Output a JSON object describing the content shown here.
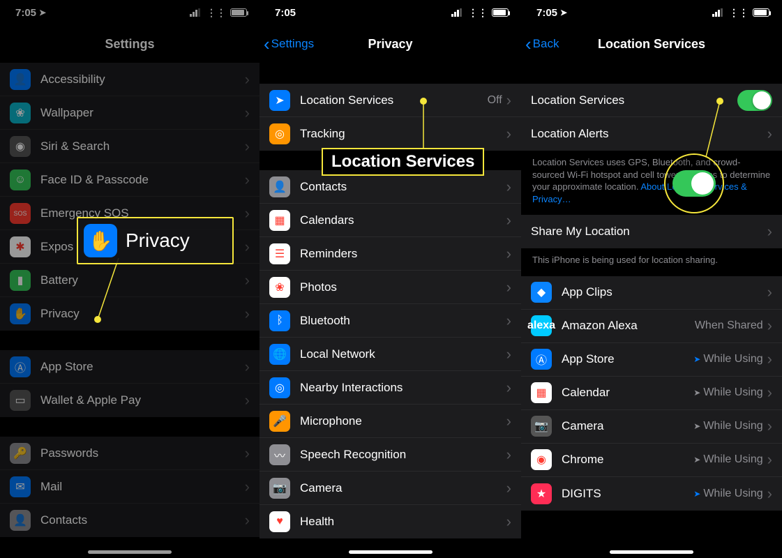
{
  "status": {
    "time": "7:05"
  },
  "screen1": {
    "title": "Settings",
    "group1": [
      {
        "label": "Accessibility",
        "icon": "👤",
        "bg": "bg-blue",
        "name": "accessibility"
      },
      {
        "label": "Wallpaper",
        "icon": "❀",
        "bg": "bg-cyan",
        "name": "wallpaper"
      },
      {
        "label": "Siri & Search",
        "icon": "◉",
        "bg": "bg-darkgray",
        "name": "siri-search"
      },
      {
        "label": "Face ID & Passcode",
        "icon": "☺",
        "bg": "bg-green",
        "name": "faceid"
      },
      {
        "label": "Emergency SOS",
        "icon": "SOS",
        "bg": "bg-red",
        "name": "emergency-sos",
        "small": true
      },
      {
        "label": "Exposure Notifications",
        "icon": "✱",
        "bg": "bg-white",
        "name": "exposure",
        "cut": "Expos"
      },
      {
        "label": "Battery",
        "icon": "▮",
        "bg": "bg-green",
        "name": "battery"
      },
      {
        "label": "Privacy",
        "icon": "✋",
        "bg": "bg-blue",
        "name": "privacy"
      }
    ],
    "group2": [
      {
        "label": "App Store",
        "icon": "Ⓐ",
        "bg": "bg-blue",
        "name": "app-store"
      },
      {
        "label": "Wallet & Apple Pay",
        "icon": "▭",
        "bg": "bg-darkgray",
        "name": "wallet"
      }
    ],
    "group3": [
      {
        "label": "Passwords",
        "icon": "🔑",
        "bg": "bg-gray",
        "name": "passwords"
      },
      {
        "label": "Mail",
        "icon": "✉",
        "bg": "bg-blue",
        "name": "mail"
      },
      {
        "label": "Contacts",
        "icon": "👤",
        "bg": "bg-gray",
        "name": "contacts"
      }
    ],
    "callout_label": "Privacy"
  },
  "screen2": {
    "back": "Settings",
    "title": "Privacy",
    "group1": [
      {
        "label": "Location Services",
        "icon": "➤",
        "bg": "bg-blue",
        "value": "Off",
        "name": "location-services"
      },
      {
        "label": "Tracking",
        "icon": "◎",
        "bg": "bg-orange",
        "name": "tracking"
      }
    ],
    "group2": [
      {
        "label": "Contacts",
        "icon": "👤",
        "bg": "bg-gray",
        "name": "contacts"
      },
      {
        "label": "Calendars",
        "icon": "▦",
        "bg": "bg-white",
        "name": "calendars"
      },
      {
        "label": "Reminders",
        "icon": "☰",
        "bg": "bg-white",
        "name": "reminders"
      },
      {
        "label": "Photos",
        "icon": "❀",
        "bg": "bg-white",
        "name": "photos"
      },
      {
        "label": "Bluetooth",
        "icon": "ᛒ",
        "bg": "bg-blue",
        "name": "bluetooth"
      },
      {
        "label": "Local Network",
        "icon": "🌐",
        "bg": "bg-blue",
        "name": "local-network"
      },
      {
        "label": "Nearby Interactions",
        "icon": "◎",
        "bg": "bg-blue",
        "name": "nearby"
      },
      {
        "label": "Microphone",
        "icon": "🎤",
        "bg": "bg-orange",
        "name": "microphone"
      },
      {
        "label": "Speech Recognition",
        "icon": "〰",
        "bg": "bg-gray",
        "name": "speech"
      },
      {
        "label": "Camera",
        "icon": "📷",
        "bg": "bg-gray",
        "name": "camera"
      },
      {
        "label": "Health",
        "icon": "♥",
        "bg": "bg-white",
        "name": "health"
      }
    ],
    "callout_label": "Location Services"
  },
  "screen3": {
    "back": "Back",
    "title": "Location Services",
    "row1_label": "Location Services",
    "row2_label": "Location Alerts",
    "footer1a": "Location Services uses GPS, Bluetooth, and crowd-sourced Wi-Fi hotspot and cell tower locations to determine your approximate location. ",
    "footer1_link": "About Location Services & Privacy…",
    "row3_label": "Share My Location",
    "footer2": "This iPhone is being used for location sharing.",
    "apps": [
      {
        "label": "App Clips",
        "icon": "◆",
        "bg": "bg-clips",
        "value": "",
        "name": "app-clips"
      },
      {
        "label": "Amazon Alexa",
        "icon": "alexa",
        "bg": "bg-alexa",
        "value": "When Shared",
        "name": "alexa"
      },
      {
        "label": "App Store",
        "icon": "Ⓐ",
        "bg": "bg-blue",
        "value": "While Using",
        "name": "app-store",
        "arrow": "blue"
      },
      {
        "label": "Calendar",
        "icon": "▦",
        "bg": "bg-white",
        "value": "While Using",
        "name": "calendar",
        "arrow": "gray"
      },
      {
        "label": "Camera",
        "icon": "📷",
        "bg": "bg-darkgray",
        "value": "While Using",
        "name": "camera",
        "arrow": "gray"
      },
      {
        "label": "Chrome",
        "icon": "◉",
        "bg": "bg-white",
        "value": "While Using",
        "name": "chrome",
        "arrow": "gray"
      },
      {
        "label": "DIGITS",
        "icon": "★",
        "bg": "bg-pink",
        "value": "While Using",
        "name": "digits",
        "arrow": "blue"
      }
    ]
  }
}
